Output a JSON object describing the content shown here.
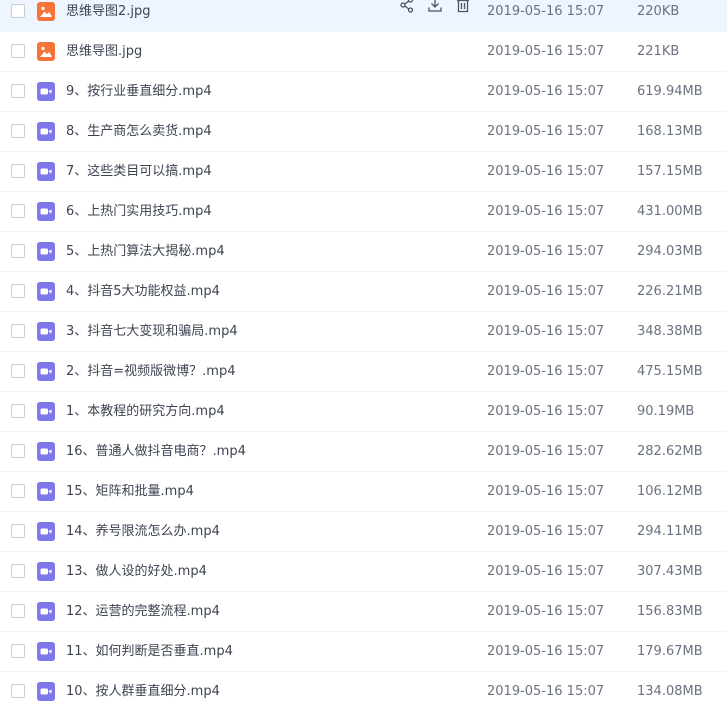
{
  "files": [
    {
      "name": "思维导图2.jpg",
      "date": "2019-05-16 15:07",
      "size": "220KB",
      "type": "image",
      "icon": "image-file-icon"
    },
    {
      "name": "思维导图.jpg",
      "date": "2019-05-16 15:07",
      "size": "221KB",
      "type": "image",
      "icon": "image-file-icon"
    },
    {
      "name": "9、按行业垂直细分.mp4",
      "date": "2019-05-16 15:07",
      "size": "619.94MB",
      "type": "video",
      "icon": "video-file-icon"
    },
    {
      "name": "8、生产商怎么卖货.mp4",
      "date": "2019-05-16 15:07",
      "size": "168.13MB",
      "type": "video",
      "icon": "video-file-icon"
    },
    {
      "name": "7、这些类目可以搞.mp4",
      "date": "2019-05-16 15:07",
      "size": "157.15MB",
      "type": "video",
      "icon": "video-file-icon"
    },
    {
      "name": "6、上热门实用技巧.mp4",
      "date": "2019-05-16 15:07",
      "size": "431.00MB",
      "type": "video",
      "icon": "video-file-icon"
    },
    {
      "name": "5、上热门算法大揭秘.mp4",
      "date": "2019-05-16 15:07",
      "size": "294.03MB",
      "type": "video",
      "icon": "video-file-icon"
    },
    {
      "name": "4、抖音5大功能权益.mp4",
      "date": "2019-05-16 15:07",
      "size": "226.21MB",
      "type": "video",
      "icon": "video-file-icon"
    },
    {
      "name": "3、抖音七大变现和骗局.mp4",
      "date": "2019-05-16 15:07",
      "size": "348.38MB",
      "type": "video",
      "icon": "video-file-icon"
    },
    {
      "name": "2、抖音=视频版微博？.mp4",
      "date": "2019-05-16 15:07",
      "size": "475.15MB",
      "type": "video",
      "icon": "video-file-icon"
    },
    {
      "name": "1、本教程的研究方向.mp4",
      "date": "2019-05-16 15:07",
      "size": "90.19MB",
      "type": "video",
      "icon": "video-file-icon"
    },
    {
      "name": "16、普通人做抖音电商？.mp4",
      "date": "2019-05-16 15:07",
      "size": "282.62MB",
      "type": "video",
      "icon": "video-file-icon"
    },
    {
      "name": "15、矩阵和批量.mp4",
      "date": "2019-05-16 15:07",
      "size": "106.12MB",
      "type": "video",
      "icon": "video-file-icon"
    },
    {
      "name": "14、养号限流怎么办.mp4",
      "date": "2019-05-16 15:07",
      "size": "294.11MB",
      "type": "video",
      "icon": "video-file-icon"
    },
    {
      "name": "13、做人设的好处.mp4",
      "date": "2019-05-16 15:07",
      "size": "307.43MB",
      "type": "video",
      "icon": "video-file-icon"
    },
    {
      "name": "12、运营的完整流程.mp4",
      "date": "2019-05-16 15:07",
      "size": "156.83MB",
      "type": "video",
      "icon": "video-file-icon"
    },
    {
      "name": "11、如何判断是否垂直.mp4",
      "date": "2019-05-16 15:07",
      "size": "179.67MB",
      "type": "video",
      "icon": "video-file-icon"
    },
    {
      "name": "10、按人群垂直细分.mp4",
      "date": "2019-05-16 15:07",
      "size": "134.08MB",
      "type": "video",
      "icon": "video-file-icon"
    }
  ],
  "hovered_row_index": 0,
  "row_actions": [
    "share-icon",
    "download-icon",
    "delete-icon"
  ],
  "colors": {
    "hover_background": "#eef5fe",
    "image_icon": "#f6733a",
    "video_icon": "#7f78e8",
    "name_text": "#3d4452",
    "meta_text": "#6b7280",
    "action_icon": "#4b5563"
  }
}
